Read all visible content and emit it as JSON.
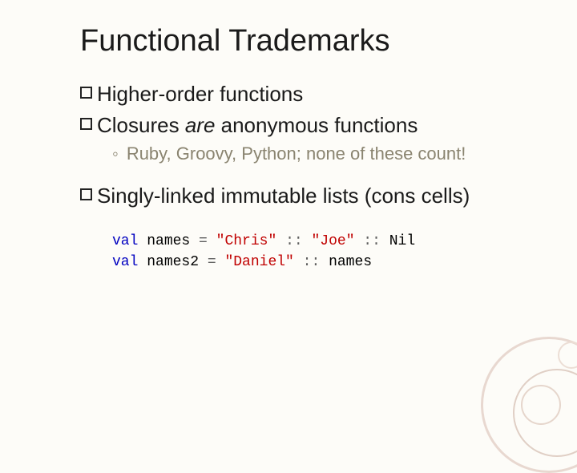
{
  "title": "Functional Trademarks",
  "b1": "Higher-order functions",
  "b2_pre": "Closures ",
  "b2_em": "are",
  "b2_post": " anonymous functions",
  "sub1": "Ruby, Groovy, Python; none of these count!",
  "b3": "Singly-linked immutable lists (cons cells)",
  "code": {
    "kw": "val",
    "names": "names",
    "names2": "names2",
    "eq": " = ",
    "chris": "\"Chris\"",
    "joe": "\"Joe\"",
    "daniel": "\"Daniel\"",
    "cons": " :: ",
    "nil": "Nil"
  }
}
